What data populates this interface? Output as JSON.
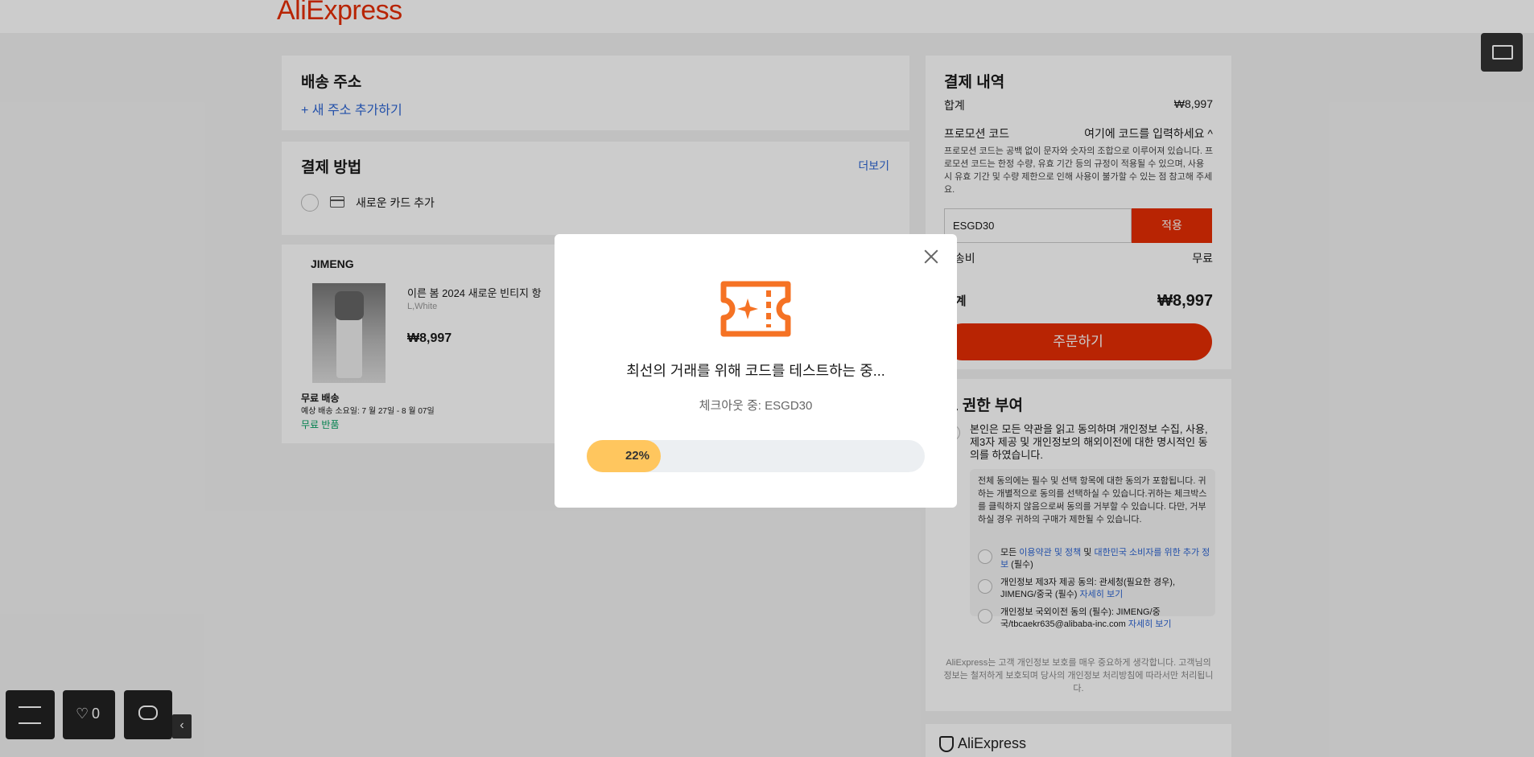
{
  "header": {
    "logo": "AliExpress"
  },
  "shipping": {
    "title": "배송 주소",
    "add_link": "+ 새 주소 추가하기"
  },
  "payment": {
    "title": "결제 방법",
    "more": "더보기",
    "add_card": "새로운 카드 추가"
  },
  "item": {
    "store": "JIMENG",
    "title": "이른 봄 2024 새로운 빈티지 항",
    "variant": "L,White",
    "price": "₩8,997",
    "free_shipping": "무료 배송",
    "delivery": "예상 배송 소요일: 7 월 27일 - 8 월 07일",
    "free_return": "무료 반품"
  },
  "summary": {
    "title": "결제 내역",
    "subtotal_label": "합계",
    "subtotal_value": "₩8,997",
    "promo_label": "프로모션 코드",
    "promo_toggle": "여기에 코드를 입력하세요 ^",
    "promo_desc": "프로모션 코드는 공백 없이 문자와 숫자의 조합으로 이루어져 있습니다. 프로모션 코드는 한정 수량, 유효 기간 등의 규정이 적용될 수 있으며, 사용 시 유효 기간 및 수량 제한으로 인해 사용이 불가할 수 있는 점 참고해 주세요.",
    "code_value": "ESGD30",
    "apply": "적용",
    "shipping_label": "배송비",
    "shipping_value": "무료",
    "total_label": "합계",
    "total_value": "₩8,997",
    "order_button": "주문하기"
  },
  "consent": {
    "title": "보 권한 부여",
    "main": "본인은 모든 약관을 읽고 동의하며 개인정보 수집, 사용, 제3자 제공 및 개인정보의 해외이전에 대한 명시적인 동의를 하였습니다.",
    "inner_desc": "전체 동의에는 필수 및 선택 항목에 대한 동의가 포함됩니다. 귀하는 개별적으로 동의를 선택하실 수 있습니다.귀하는 체크박스를 클릭하지 않음으로써 동의를 거부할 수 있습니다. 다만, 거부하실 경우 귀하의 구매가 제한될 수 있습니다.",
    "item1_pre": "모든 ",
    "item1_link1": "이용약관 및 정책",
    "item1_mid": " 및 ",
    "item1_link2": "대한민국 소비자를 위한 추가 정보",
    "item1_post": " (필수)",
    "item2_text": "개인정보 제3자 제공 동의: 관세청(필요한 경우), JIMENG/중국 (필수) ",
    "item2_link": "자세히 보기",
    "item3_text": "개인정보 국외이전 동의 (필수): JIMENG/중국/tbcaekr635@alibaba-inc.com ",
    "item3_link": "자세히 보기",
    "footer": "AliExpress는 고객 개인정보 보호를 매우 중요하게 생각합니다. 고객님의 정보는 철저하게 보호되며 당사의 개인정보 처리방침에 따라서만 처리됩니다."
  },
  "brand": {
    "name": "AliExpress"
  },
  "floating": {
    "wishlist_count": "0",
    "heart": "♡",
    "collapse": "‹"
  },
  "modal": {
    "title": "최선의 거래를 위해 코드를 테스트하는 중...",
    "subtitle": "체크아웃 중: ESGD30",
    "progress": 0.22,
    "progress_label": "22%",
    "accent": "#f57224",
    "bar_color": "#ffc65e"
  },
  "colors": {
    "brand": "#e62e04",
    "link": "#2c65d4",
    "green": "#00a161"
  }
}
